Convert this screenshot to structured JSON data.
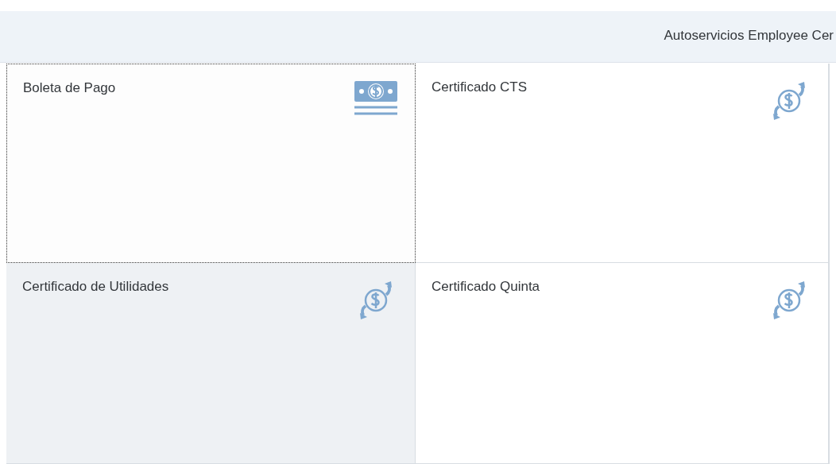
{
  "header": {
    "title": "Autoservicios Employee Cer"
  },
  "tiles": [
    {
      "title": "Boleta de Pago",
      "kind": "bill",
      "focused": true,
      "hovered": false
    },
    {
      "title": "Certificado CTS",
      "kind": "exchange",
      "focused": false,
      "hovered": false
    },
    {
      "title": "Certificado de Utilidades",
      "kind": "exchange",
      "focused": false,
      "hovered": true
    },
    {
      "title": "Certificado Quinta",
      "kind": "exchange",
      "focused": false,
      "hovered": false
    }
  ]
}
